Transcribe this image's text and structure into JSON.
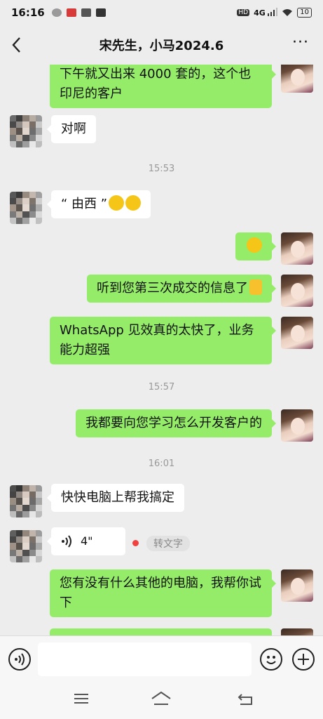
{
  "status_bar": {
    "time": "16:16",
    "network": "4G",
    "battery": "10",
    "left_icons": [
      "wechat-icon",
      "app-icon",
      "app-icon",
      "app-icon"
    ],
    "right_icons": [
      "hd-icon",
      "signal-icon",
      "wifi-icon",
      "battery-icon"
    ]
  },
  "header": {
    "title": "宋先生，小马2024.6",
    "back_icon": "chevron-left-icon",
    "more_icon": "more-dots-icon",
    "more_label": "···"
  },
  "messages": [
    {
      "side": "out",
      "text": "下午就又出来 4000 套的，这个也印尼的客户"
    },
    {
      "side": "in",
      "text": "对啊"
    },
    {
      "timestamp": "15:53"
    },
    {
      "side": "in",
      "text": "“ 由西 ”",
      "emoji": [
        "laughing-emoji",
        "laughing-emoji"
      ]
    },
    {
      "side": "out",
      "text": "",
      "emoji": [
        "confused-emoji"
      ]
    },
    {
      "side": "out",
      "text": "听到您第三次成交的信息了",
      "emoji": [
        "thumbs-up-emoji"
      ]
    },
    {
      "side": "out",
      "text": "WhatsApp 见效真的太快了，业务能力超强"
    },
    {
      "timestamp": "15:57"
    },
    {
      "side": "out",
      "text": "我都要向您学习怎么开发客户的"
    },
    {
      "timestamp": "16:01"
    },
    {
      "side": "in",
      "text": "快快电脑上帮我搞定"
    },
    {
      "side": "in",
      "voice_duration": "4\"",
      "transcribe_label": "转文字",
      "unread": true
    },
    {
      "side": "out",
      "text": "您有没有什么其他的电脑，我帮你试下"
    }
  ],
  "input_bar": {
    "voice_icon": "voice-input-icon",
    "emoji_icon": "emoji-icon",
    "plus_icon": "plus-icon"
  },
  "system_nav": [
    "menu-icon",
    "home-icon",
    "back-icon"
  ],
  "colors": {
    "background": "#ededed",
    "bubble_out": "#95ec69",
    "bubble_in": "#ffffff",
    "timestamp": "#999999",
    "unread_dot": "#f04040"
  }
}
